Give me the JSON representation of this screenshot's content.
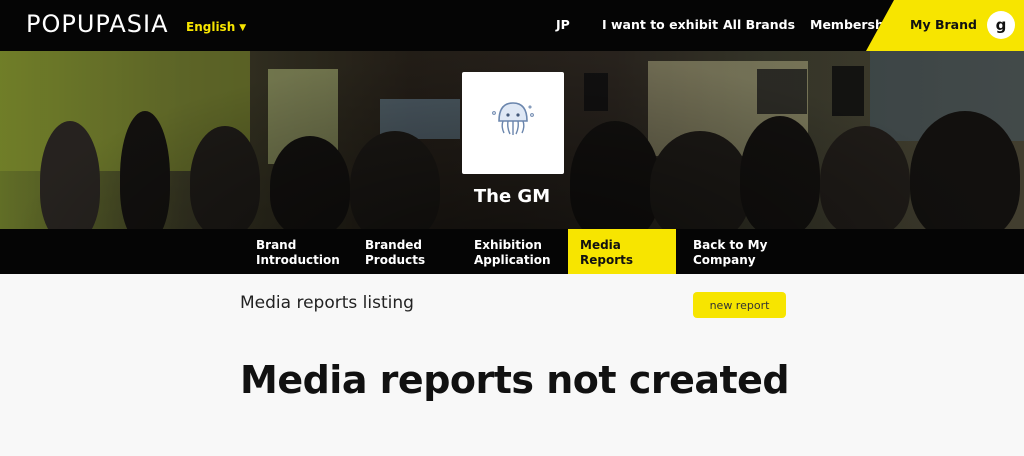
{
  "header": {
    "logo": "POPUPASIA",
    "language": "English",
    "nav": [
      {
        "label": "JP"
      },
      {
        "label": "I want to exhibit"
      },
      {
        "label": "All Brands"
      },
      {
        "label": "Membership"
      }
    ],
    "my_brand": "My Brand",
    "avatar_letter": "g"
  },
  "brand": {
    "name": "The GM"
  },
  "tabs": [
    {
      "label_line1": "Brand",
      "label_line2": "Introduction"
    },
    {
      "label_line1": "Branded",
      "label_line2": "Products"
    },
    {
      "label_line1": "Exhibition",
      "label_line2": "Application"
    },
    {
      "label_line1": "Media",
      "label_line2": "Reports",
      "active": true
    },
    {
      "label_line1": "Back to My",
      "label_line2": "Company"
    }
  ],
  "content": {
    "section_title": "Media reports listing",
    "new_button": "new report",
    "empty_message": "Media reports not created"
  },
  "colors": {
    "accent": "#f7e500",
    "bar": "#050505"
  }
}
